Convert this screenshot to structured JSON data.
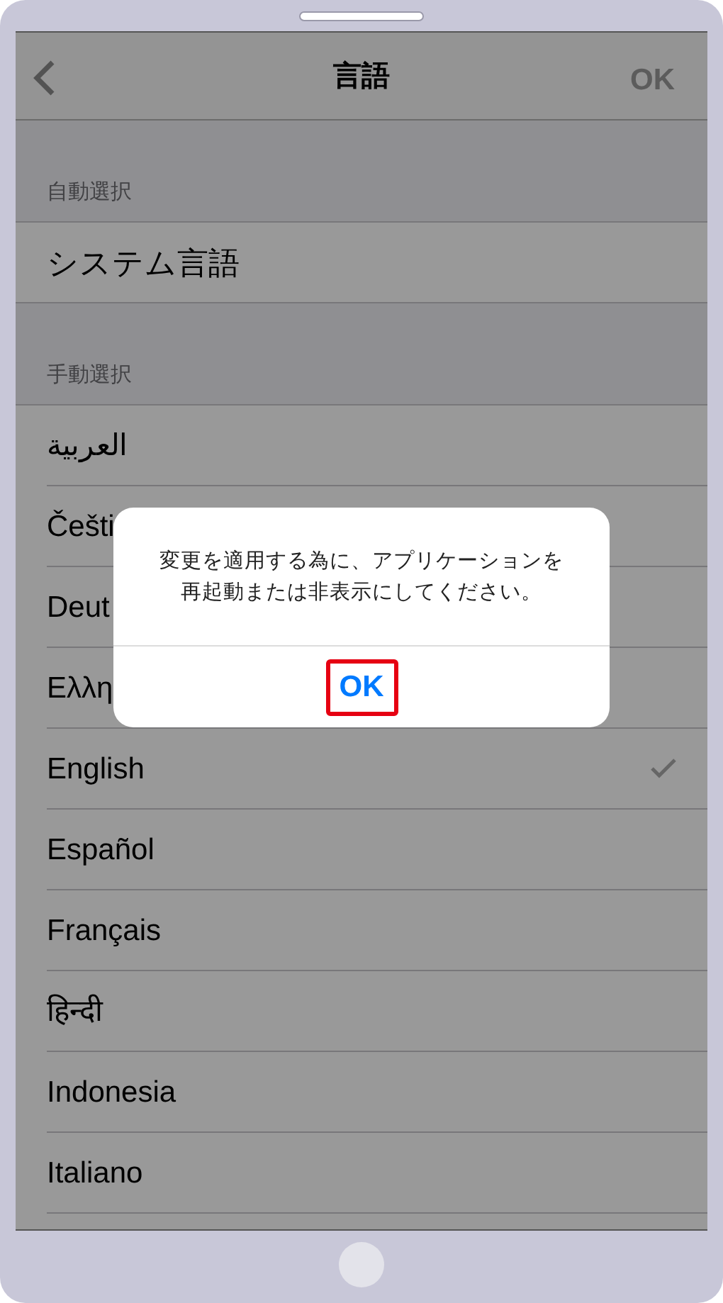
{
  "nav_bar": {
    "title": "言語",
    "done_button": "OK"
  },
  "sections": [
    {
      "header": "自動選択",
      "rows": [
        {
          "label": "システム言語",
          "selected": false
        }
      ]
    },
    {
      "header": "手動選択",
      "rows": [
        {
          "label": "العربية",
          "selected": false
        },
        {
          "label": "Češti",
          "selected": false
        },
        {
          "label": "Deut",
          "selected": false
        },
        {
          "label": "Ελλη",
          "selected": false
        },
        {
          "label": "English",
          "selected": true
        },
        {
          "label": "Español",
          "selected": false
        },
        {
          "label": "Français",
          "selected": false
        },
        {
          "label": "हिन्दी",
          "selected": false
        },
        {
          "label": "Indonesia",
          "selected": false
        },
        {
          "label": "Italiano",
          "selected": false
        }
      ]
    }
  ],
  "alert": {
    "message_lines": [
      "変更を適用する為に、アプリケーションを",
      "再起動または非表示にしてください。"
    ],
    "button": "OK"
  }
}
